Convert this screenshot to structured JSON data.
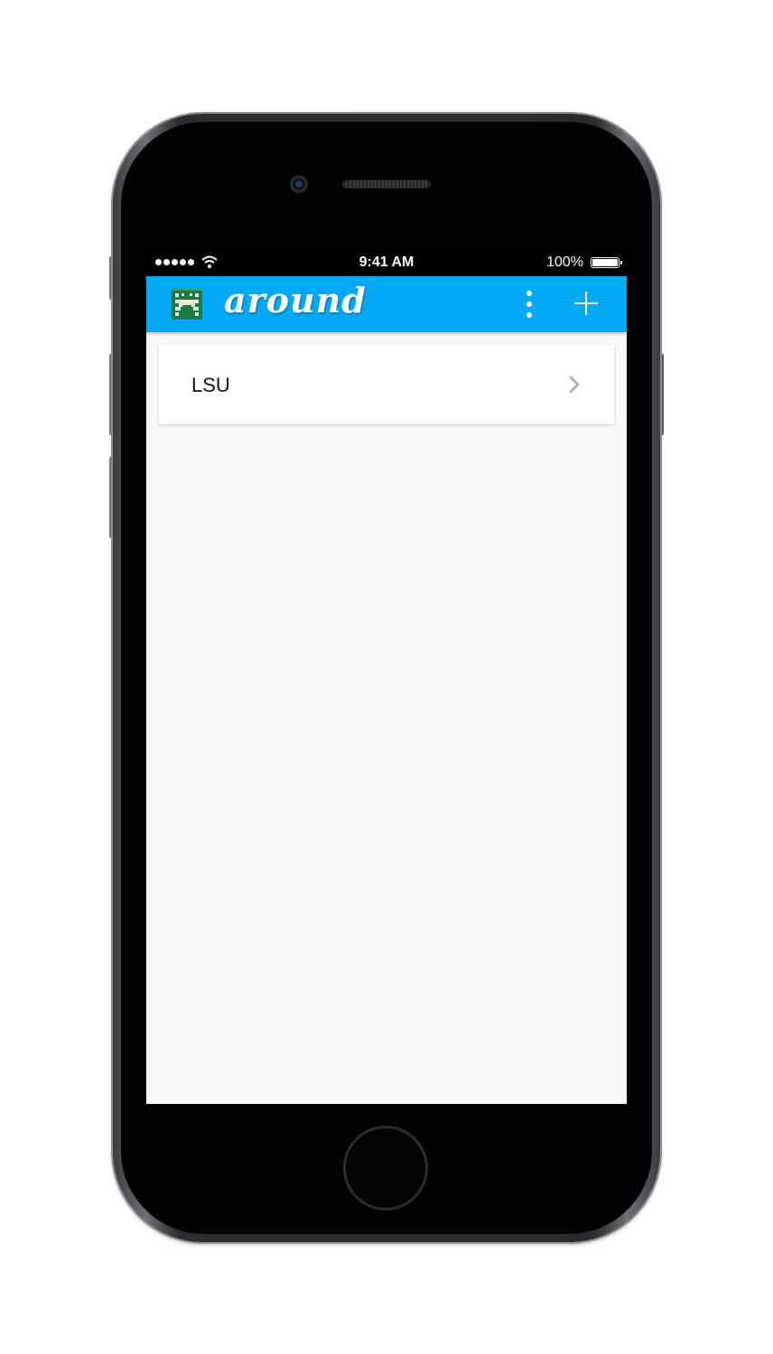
{
  "status_bar": {
    "time": "9:41 AM",
    "battery": "100%",
    "signal_icon": "signal-dots-icon",
    "wifi_icon": "wifi-icon",
    "battery_icon": "battery-full-icon"
  },
  "app_bar": {
    "title": "around",
    "logo_icon": "pixel-logo-icon",
    "menu_icon": "more-vertical-icon",
    "add_icon": "plus-icon",
    "color": "#03a9f4"
  },
  "list": {
    "items": [
      {
        "label": "LSU",
        "icon": "chevron-right-icon"
      }
    ]
  },
  "colors": {
    "app_bar": "#03a9f4",
    "logo_green": "#1b7a45",
    "screen_background": "#f8f8f8",
    "chevron": "#b3b3b3"
  }
}
